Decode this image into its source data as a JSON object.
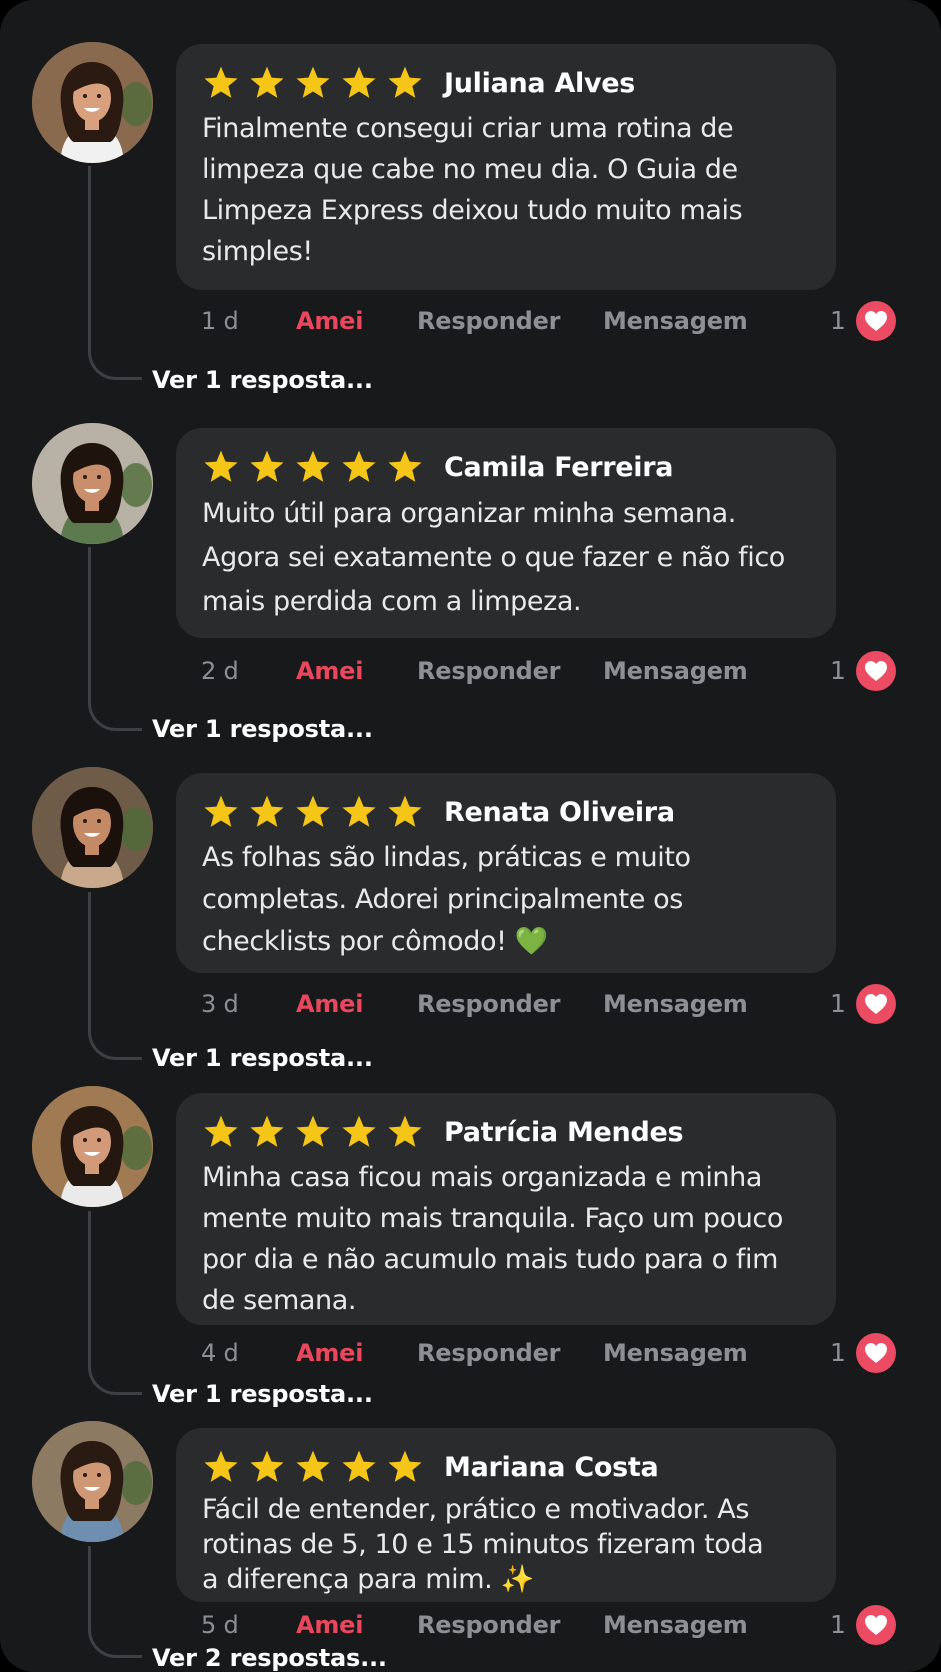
{
  "colors": {
    "background": "#18191a",
    "bubble": "#2a2b2d",
    "star": "#f5c518",
    "love": "#e9475e",
    "heart_badge": "#ec4c63",
    "muted": "#8c8f93"
  },
  "icons": {
    "star": "star-icon",
    "heart": "heart-icon",
    "avatar": "avatar-photo"
  },
  "comments": [
    {
      "name": "Juliana Alves",
      "rating": 5,
      "text": "Finalmente consegui criar uma rotina de\nlimpeza que cabe no meu dia. O Guia de\nLimpeza Express deixou tudo muito mais\nsimples!",
      "time": "1 d",
      "love_label": "Amei",
      "reply_label": "Responder",
      "message_label": "Mensagem",
      "likes": "1",
      "replies": "Ver 1 resposta..."
    },
    {
      "name": "Camila Ferreira",
      "rating": 5,
      "text": "Muito útil para organizar minha semana.\nAgora sei exatamente o que fazer e não fico\nmais perdida com a limpeza.",
      "time": "2 d",
      "love_label": "Amei",
      "reply_label": "Responder",
      "message_label": "Mensagem",
      "likes": "1",
      "replies": "Ver 1 resposta..."
    },
    {
      "name": "Renata Oliveira",
      "rating": 5,
      "text": "As folhas são lindas, práticas e muito\ncompletas. Adorei principalmente os\nchecklists por cômodo! 💚",
      "time": "3 d",
      "love_label": "Amei",
      "reply_label": "Responder",
      "message_label": "Mensagem",
      "likes": "1",
      "replies": "Ver 1 resposta..."
    },
    {
      "name": "Patrícia Mendes",
      "rating": 5,
      "text": "Minha casa ficou mais organizada e minha\nmente muito mais tranquila. Faço um pouco\npor dia e não acumulo mais tudo para o fim\nde semana.",
      "time": "4 d",
      "love_label": "Amei",
      "reply_label": "Responder",
      "message_label": "Mensagem",
      "likes": "1",
      "replies": "Ver 1 resposta..."
    },
    {
      "name": "Mariana Costa",
      "rating": 5,
      "text": "Fácil de entender, prático e motivador. As\nrotinas de 5, 10 e 15 minutos fizeram toda\na diferença para mim. ✨",
      "time": "5 d",
      "love_label": "Amei",
      "reply_label": "Responder",
      "message_label": "Mensagem",
      "likes": "1",
      "replies": "Ver 2 respostas..."
    }
  ]
}
